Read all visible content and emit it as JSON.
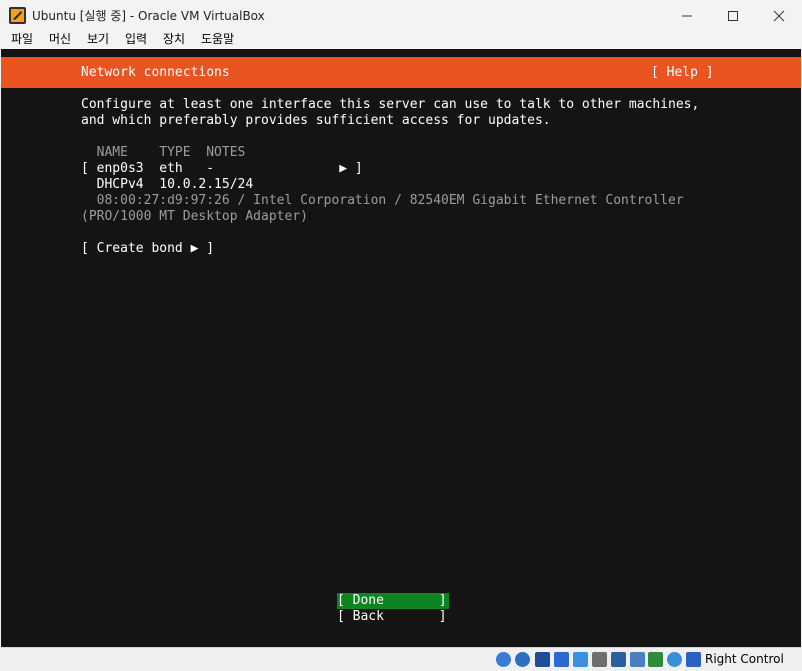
{
  "window": {
    "title": "Ubuntu [실행 중] - Oracle VM VirtualBox",
    "app_icon": "virtualbox-icon"
  },
  "menu": [
    "파일",
    "머신",
    "보기",
    "입력",
    "장치",
    "도움말"
  ],
  "installer": {
    "header_title": "Network connections",
    "help_label": "[ Help ]",
    "intro_line1": "Configure at least one interface this server can use to talk to other machines,",
    "intro_line2": "and which preferably provides sufficient access for updates.",
    "table_header": "  NAME    TYPE  NOTES",
    "iface_row": "[ enp0s3  eth   -                ▶ ]",
    "dhcp_row": "  DHCPv4  10.0.2.15/24",
    "mac_row": "  08:00:27:d9:97:26 / Intel Corporation / 82540EM Gigabit Ethernet Controller",
    "adapter_row": "(PRO/1000 MT Desktop Adapter)",
    "create_bond": "[ Create bond ▶ ]",
    "done_button": "[ Done       ]",
    "back_button": "[ Back       ]"
  },
  "statusbar": {
    "host_key": "Right Control"
  }
}
